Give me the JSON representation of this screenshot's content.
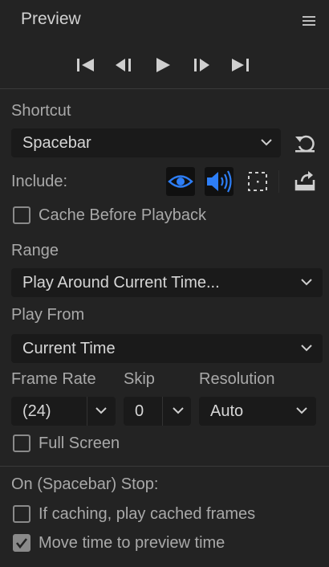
{
  "panel": {
    "title": "Preview",
    "menu_icon": "hamburger-menu-icon"
  },
  "transport": {
    "buttons": [
      {
        "name": "go-to-first-frame-icon"
      },
      {
        "name": "previous-frame-icon"
      },
      {
        "name": "play-icon"
      },
      {
        "name": "next-frame-icon"
      },
      {
        "name": "go-to-last-frame-icon"
      }
    ]
  },
  "shortcut": {
    "label": "Shortcut",
    "value": "Spacebar",
    "reset_icon": "reset-icon"
  },
  "include": {
    "label": "Include:",
    "icons": [
      "eye-icon",
      "speaker-icon",
      "overlay-icon"
    ],
    "active_color": "#2d7ef7",
    "export_icon": "export-icon"
  },
  "cache_before_playback": {
    "label": "Cache Before Playback",
    "checked": false
  },
  "range": {
    "label": "Range",
    "value": "Play Around Current Time..."
  },
  "play_from": {
    "label": "Play From",
    "value": "Current Time"
  },
  "frame_rate": {
    "label": "Frame Rate",
    "value": "(24)"
  },
  "skip": {
    "label": "Skip",
    "value": "0"
  },
  "resolution": {
    "label": "Resolution",
    "value": "Auto"
  },
  "full_screen": {
    "label": "Full Screen",
    "checked": false
  },
  "on_stop": {
    "label": "On (Spacebar) Stop:",
    "options": [
      {
        "label": "If caching, play cached frames",
        "checked": false
      },
      {
        "label": "Move time to preview time",
        "checked": true
      }
    ]
  }
}
